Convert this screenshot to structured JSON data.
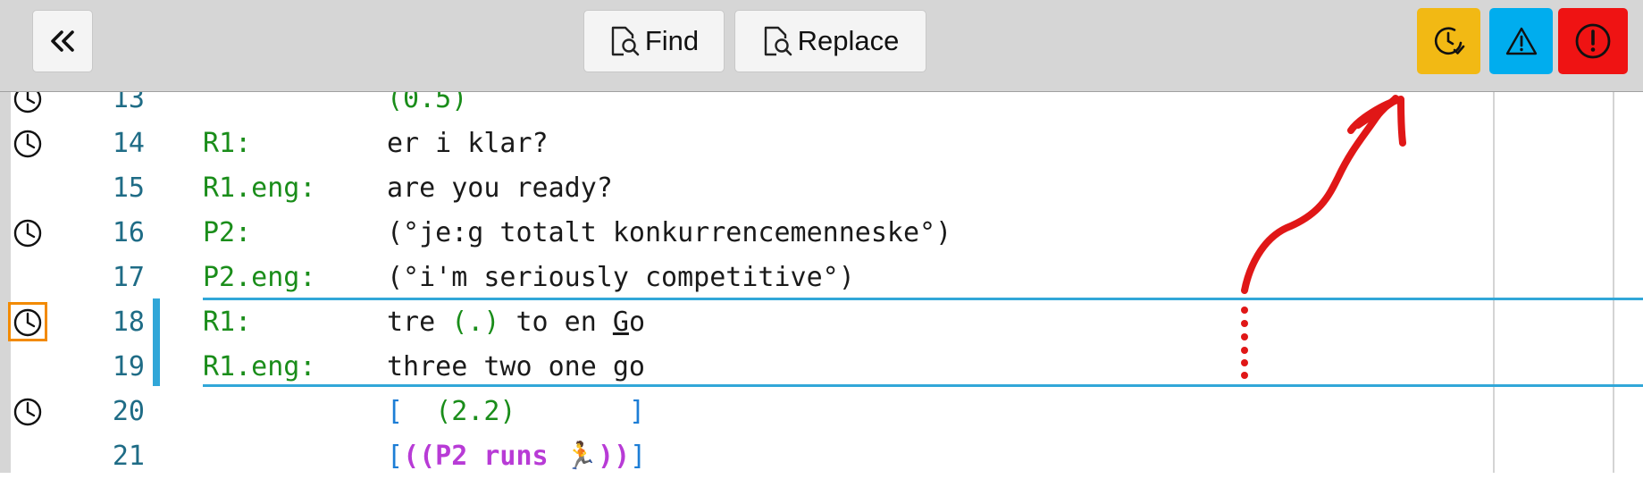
{
  "toolbar": {
    "collapse_glyph": "«",
    "find_label": "Find",
    "replace_label": "Replace",
    "status_buttons": {
      "timing": {
        "icon": "clock-check-icon",
        "color": "#f2b914"
      },
      "warning": {
        "icon": "warning-triangle-icon",
        "color": "#00adee"
      },
      "error": {
        "icon": "error-circle-icon",
        "color": "#ef1313"
      }
    }
  },
  "lines": [
    {
      "num": "13",
      "speaker": "",
      "utterance": "(0.5)"
    },
    {
      "num": "14",
      "speaker": "R1:",
      "utterance": "er i klar?"
    },
    {
      "num": "15",
      "speaker": "R1.eng:",
      "utterance": "are you ready?"
    },
    {
      "num": "16",
      "speaker": "P2:",
      "utterance": "(°je:g totalt konkurrencemenneske°)"
    },
    {
      "num": "17",
      "speaker": "P2.eng:",
      "utterance": "(°i'm seriously competitive°)"
    },
    {
      "num": "18",
      "speaker": "R1:",
      "utt_parts": {
        "a": "tre ",
        "b": "(.)",
        "c": " to en ",
        "d": "G",
        "e": "o"
      }
    },
    {
      "num": "19",
      "speaker": "R1.eng:",
      "utterance": "three two one go"
    },
    {
      "num": "20",
      "speaker": "",
      "utt_parts": {
        "open": "[",
        "gap1": "  ",
        "pause": "(2.2)",
        "gap2": "       ",
        "close": "]"
      }
    },
    {
      "num": "21",
      "speaker": "",
      "utt_parts": {
        "open": "[",
        "action": "((P2 runs ",
        "emoji": "🏃",
        "action_end": "))",
        "close": "]"
      }
    }
  ],
  "colors": {
    "line_number": "#1f6c86",
    "speaker": "#1a8d1a",
    "selection": "#31a7d8",
    "selected_marker": "#f28a00",
    "annotation": "#e01717"
  }
}
